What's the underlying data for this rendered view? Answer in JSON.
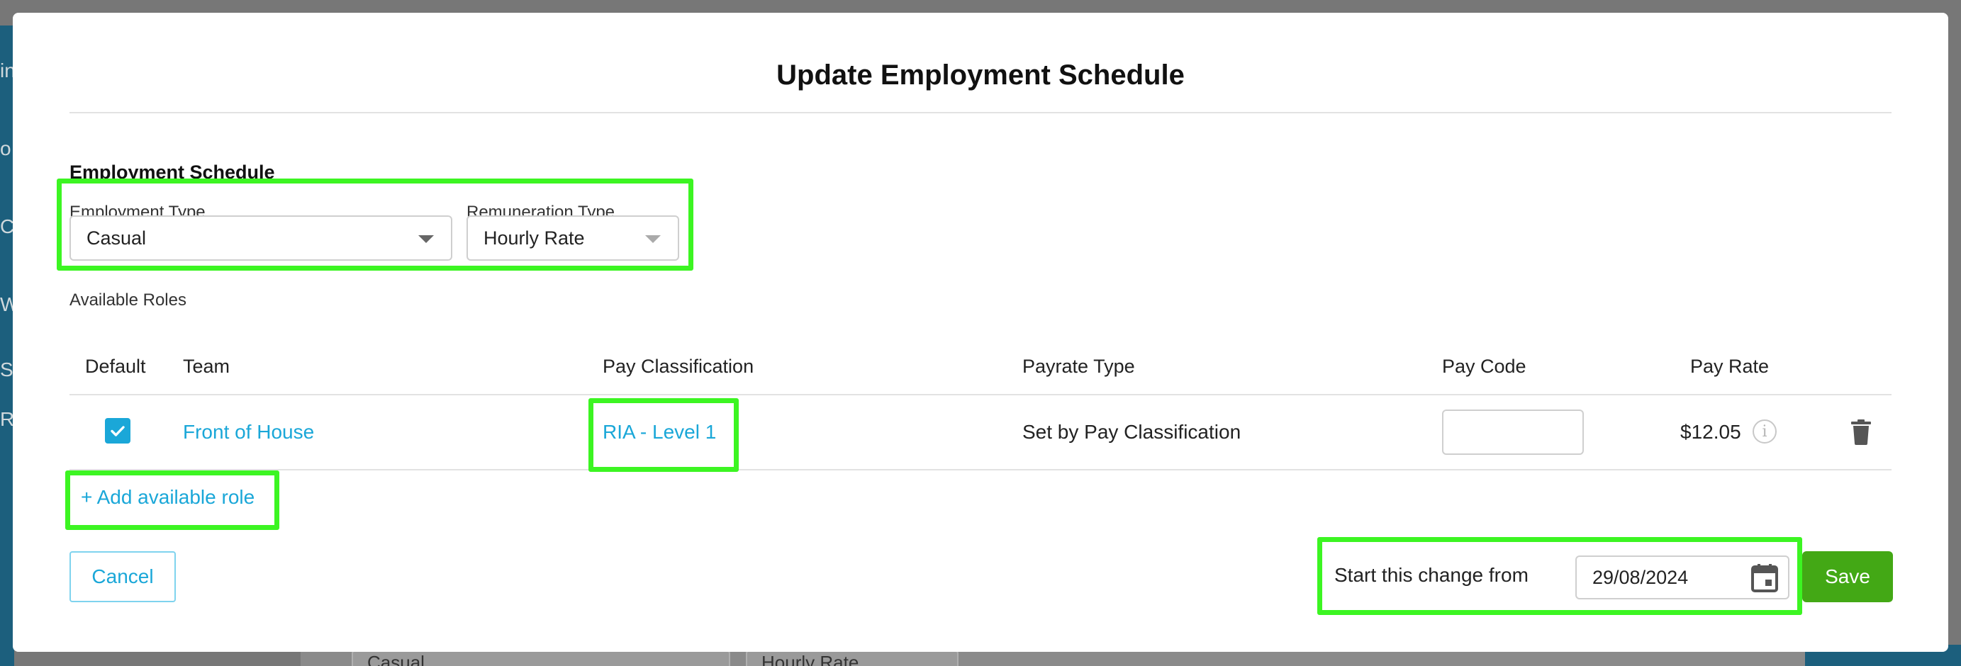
{
  "background": {
    "sidebar_fragments": [
      "in",
      "o",
      "Co",
      "W",
      "S",
      "R"
    ],
    "bottom_inputs": [
      "Casual",
      "Hourly Rate"
    ]
  },
  "modal": {
    "title": "Update Employment Schedule",
    "section_heading": "Employment Schedule",
    "employment_type": {
      "label": "Employment Type",
      "value": "Casual"
    },
    "remuneration_type": {
      "label": "Remuneration Type",
      "value": "Hourly Rate"
    },
    "available_roles_label": "Available Roles",
    "table": {
      "headers": [
        "Default",
        "Team",
        "Pay Classification",
        "Payrate Type",
        "Pay Code",
        "Pay Rate"
      ],
      "rows": [
        {
          "default_checked": true,
          "team": "Front of House",
          "pay_classification": "RIA - Level 1",
          "payrate_type": "Set by Pay Classification",
          "pay_code": "",
          "pay_rate": "$12.05"
        }
      ]
    },
    "add_role_label": "+ Add available role",
    "cancel_label": "Cancel",
    "start_change_label": "Start this change from",
    "start_date": "29/08/2024",
    "save_label": "Save"
  },
  "colors": {
    "accent_link": "#1aa7d8",
    "save_green": "#43a815",
    "highlight_green": "#3cf522"
  },
  "icons": [
    "chevron-down-icon",
    "checkmark-icon",
    "info-icon",
    "trash-icon",
    "calendar-icon"
  ]
}
